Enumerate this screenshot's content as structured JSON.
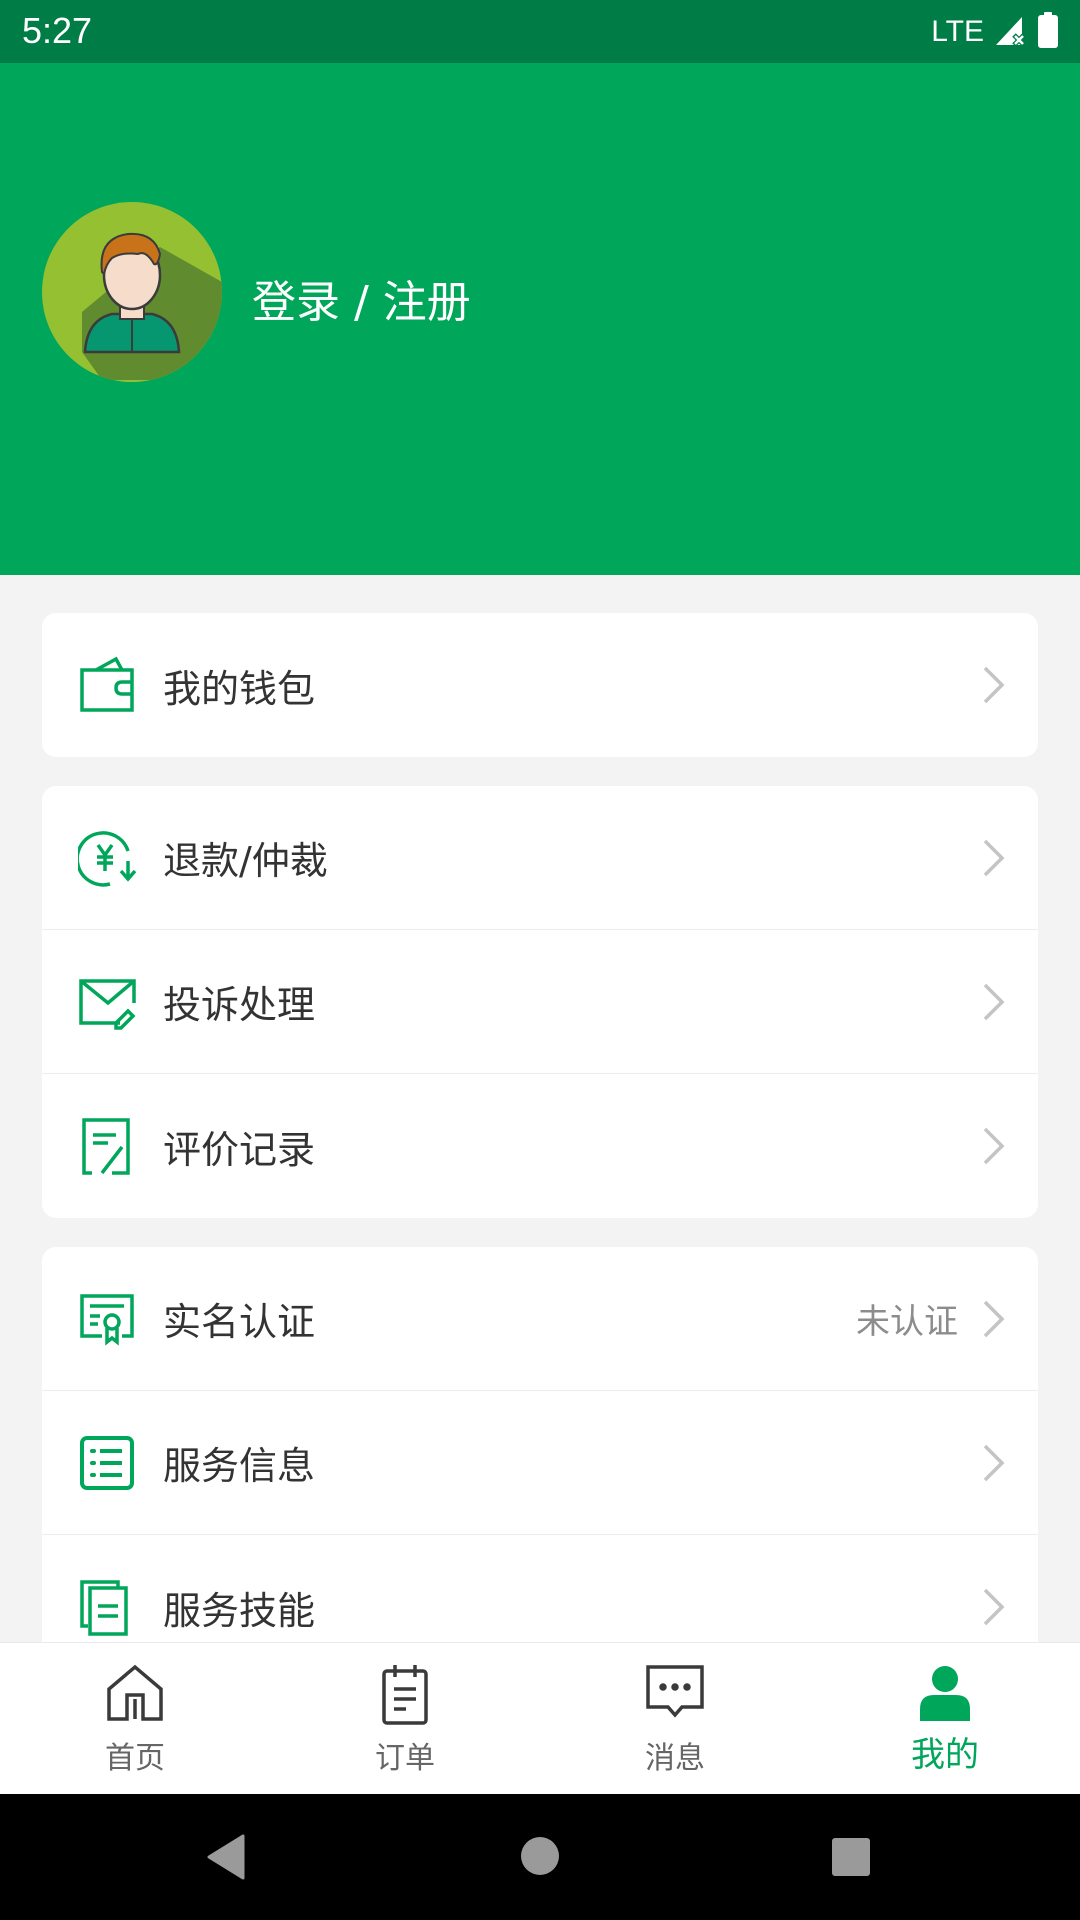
{
  "status_bar": {
    "time": "5:27",
    "network": "LTE",
    "icons": [
      "signal-icon",
      "battery-icon"
    ]
  },
  "header": {
    "login_label": "登录 / 注册",
    "avatar_icon": "user-avatar-icon"
  },
  "colors": {
    "brand": "#00a65a",
    "status_bar": "#007d47",
    "background": "#f3f3f3",
    "chevron": "#c4c4c4"
  },
  "menu": {
    "groups": [
      {
        "items": [
          {
            "icon": "wallet-icon",
            "label": "我的钱包",
            "value": ""
          }
        ]
      },
      {
        "items": [
          {
            "icon": "refund-icon",
            "label": "退款/仲裁",
            "value": ""
          },
          {
            "icon": "complaint-mail-icon",
            "label": "投诉处理",
            "value": ""
          },
          {
            "icon": "review-record-icon",
            "label": "评价记录",
            "value": ""
          }
        ]
      },
      {
        "items": [
          {
            "icon": "certificate-icon",
            "label": "实名认证",
            "value": "未认证"
          },
          {
            "icon": "list-icon",
            "label": "服务信息",
            "value": ""
          },
          {
            "icon": "documents-icon",
            "label": "服务技能",
            "value": ""
          }
        ]
      }
    ]
  },
  "tabbar": {
    "tabs": [
      {
        "icon": "home-icon",
        "label": "首页",
        "active": false
      },
      {
        "icon": "order-icon",
        "label": "订单",
        "active": false
      },
      {
        "icon": "message-icon",
        "label": "消息",
        "active": false
      },
      {
        "icon": "profile-icon",
        "label": "我的",
        "active": true
      }
    ]
  },
  "system_nav": {
    "buttons": [
      "back",
      "home",
      "recents"
    ]
  }
}
